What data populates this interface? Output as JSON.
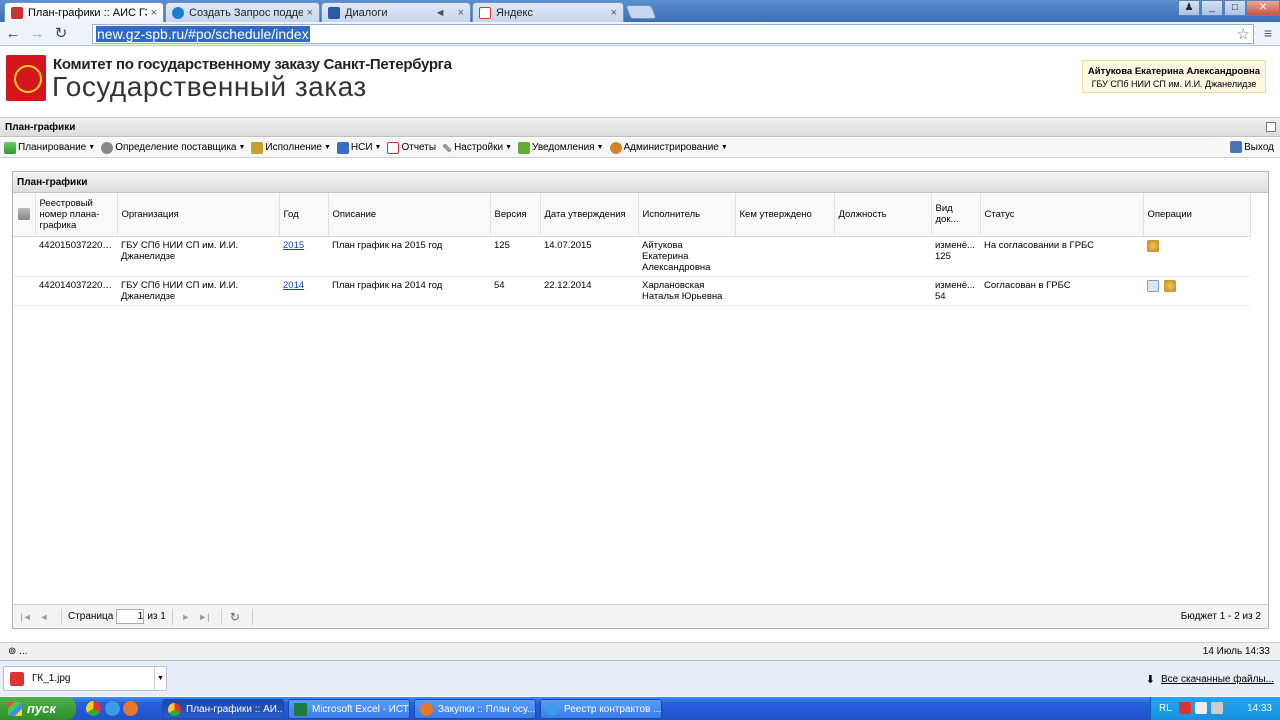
{
  "browser": {
    "tabs": [
      {
        "title": "План-графики :: АИС ГЗ",
        "active": true
      },
      {
        "title": "Создать Запрос поддержки",
        "active": false
      },
      {
        "title": "Диалоги",
        "active": false
      },
      {
        "title": "Яндекс",
        "active": false
      }
    ],
    "url": "new.gz-spb.ru/#po/schedule/index"
  },
  "header": {
    "committee": "Комитет по государственному заказу Санкт-Петербурга",
    "title": "Государственный заказ",
    "user_name": "Айтукова Екатерина Александровна",
    "user_org": "ГБУ СПб НИИ СП им. И.И. Джанелидзе"
  },
  "panel": {
    "title": "План-графики"
  },
  "menu": {
    "items": [
      {
        "label": "Планирование",
        "icon": "planning-icon"
      },
      {
        "label": "Определение поставщика",
        "icon": "gears-icon"
      },
      {
        "label": "Исполнение",
        "icon": "briefcase-icon"
      },
      {
        "label": "НСИ",
        "icon": "book-icon"
      },
      {
        "label": "Отчеты",
        "icon": "report-icon"
      },
      {
        "label": "Настройки",
        "icon": "wrench-icon"
      },
      {
        "label": "Уведомления",
        "icon": "notification-icon"
      },
      {
        "label": "Администрирование",
        "icon": "user-icon"
      }
    ],
    "exit": "Выход"
  },
  "grid": {
    "title": "План-графики",
    "columns": [
      "Реестровый номер плана-графика",
      "Организация",
      "Год",
      "Описание",
      "Версия",
      "Дата утверждения",
      "Исполнитель",
      "Кем утверждено",
      "Должность",
      "Вид док...",
      "Статус",
      "Операции"
    ],
    "rows": [
      {
        "reg": "4420150372200...",
        "org": "ГБУ СПб НИИ СП им. И.И. Джанелидзе",
        "year": "2015",
        "desc": "План график на 2015 год",
        "version": "125",
        "date": "14.07.2015",
        "executor": "Айтукова Екатерина Александровна",
        "approved_by": "",
        "position": "",
        "doc_type": "изменё... 125",
        "status": "На согласовании в ГРБС"
      },
      {
        "reg": "4420140372200...",
        "org": "ГБУ СПб НИИ СП им. И.И. Джанелидзе",
        "year": "2014",
        "desc": "План график на 2014 год",
        "version": "54",
        "date": "22.12.2014",
        "executor": "Харлановская Наталья Юрьевна",
        "approved_by": "",
        "position": "",
        "doc_type": "изменё... 54",
        "status": "Согласован в ГРБС"
      }
    ],
    "pager": {
      "page_label": "Страница",
      "page": "1",
      "of_label": "из 1",
      "info": "Бюджет 1 - 2 из 2"
    }
  },
  "statusbar": {
    "left": "...",
    "right": "14 Июль 14:33"
  },
  "downloads": {
    "file": "ГК_1.jpg",
    "all": "Все скачанные файлы..."
  },
  "taskbar": {
    "start": "пуск",
    "windows": [
      {
        "title": "План-графики :: АИ...",
        "active": true
      },
      {
        "title": "Microsoft Excel - ИСТ...",
        "active": false
      },
      {
        "title": "Закупки :: План осу...",
        "active": false
      },
      {
        "title": "Реестр контрактов ...",
        "active": false
      }
    ],
    "lang": "RL",
    "clock": "14:33"
  },
  "colors": {
    "link": "#1a3cc0",
    "emblem_red": "#d3161d",
    "xp_blue": "#245edb"
  }
}
